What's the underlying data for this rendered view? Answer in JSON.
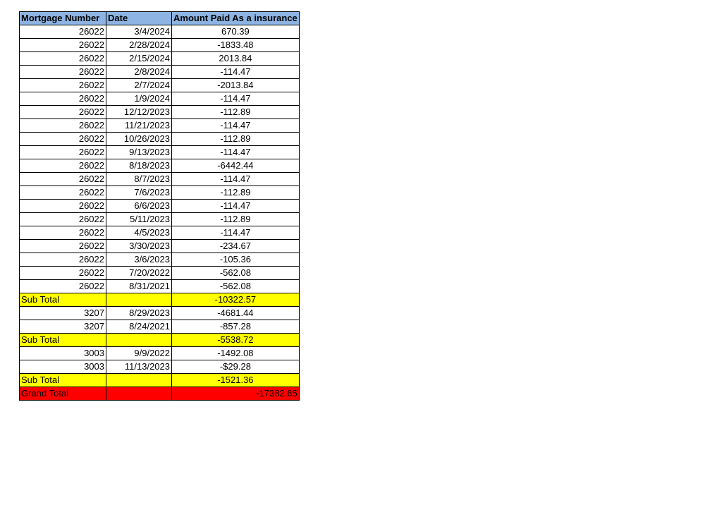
{
  "headers": {
    "mortgage_number": "Mortgage Number",
    "date": "Date",
    "amount": "Amount Paid As a insurance"
  },
  "colors": {
    "header_bg": "#8db4e2",
    "subtotal_bg": "#ffff00",
    "grandtotal_bg": "#ff0000"
  },
  "groups": [
    {
      "rows": [
        {
          "mortgage": "26022",
          "date": "3/4/2024",
          "amount": "670.39"
        },
        {
          "mortgage": "26022",
          "date": "2/28/2024",
          "amount": "-1833.48"
        },
        {
          "mortgage": "26022",
          "date": "2/15/2024",
          "amount": "2013.84"
        },
        {
          "mortgage": "26022",
          "date": "2/8/2024",
          "amount": "-114.47"
        },
        {
          "mortgage": "26022",
          "date": "2/7/2024",
          "amount": "-2013.84"
        },
        {
          "mortgage": "26022",
          "date": "1/9/2024",
          "amount": "-114.47"
        },
        {
          "mortgage": "26022",
          "date": "12/12/2023",
          "amount": "-112.89"
        },
        {
          "mortgage": "26022",
          "date": "11/21/2023",
          "amount": "-114.47"
        },
        {
          "mortgage": "26022",
          "date": "10/26/2023",
          "amount": "-112.89"
        },
        {
          "mortgage": "26022",
          "date": "9/13/2023",
          "amount": "-114.47"
        },
        {
          "mortgage": "26022",
          "date": "8/18/2023",
          "amount": "-6442.44"
        },
        {
          "mortgage": "26022",
          "date": "8/7/2023",
          "amount": "-114.47"
        },
        {
          "mortgage": "26022",
          "date": "7/6/2023",
          "amount": "-112.89"
        },
        {
          "mortgage": "26022",
          "date": "6/6/2023",
          "amount": "-114.47"
        },
        {
          "mortgage": "26022",
          "date": "5/11/2023",
          "amount": "-112.89"
        },
        {
          "mortgage": "26022",
          "date": "4/5/2023",
          "amount": "-114.47"
        },
        {
          "mortgage": "26022",
          "date": "3/30/2023",
          "amount": "-234.67"
        },
        {
          "mortgage": "26022",
          "date": "3/6/2023",
          "amount": "-105.36"
        },
        {
          "mortgage": "26022",
          "date": "7/20/2022",
          "amount": "-562.08"
        },
        {
          "mortgage": "26022",
          "date": "8/31/2021",
          "amount": "-562.08"
        }
      ],
      "subtotal_label": "Sub Total",
      "subtotal_amount": "-10322.57"
    },
    {
      "rows": [
        {
          "mortgage": "3207",
          "date": "8/29/2023",
          "amount": "-4681.44"
        },
        {
          "mortgage": "3207",
          "date": "8/24/2021",
          "amount": "-857.28"
        }
      ],
      "subtotal_label": "Sub Total",
      "subtotal_amount": "-5538.72"
    },
    {
      "rows": [
        {
          "mortgage": "3003",
          "date": "9/9/2022",
          "amount": "-1492.08"
        },
        {
          "mortgage": "3003",
          "date": "11/13/2023",
          "amount": "-$29.28"
        }
      ],
      "subtotal_label": "Sub Total",
      "subtotal_amount": "-1521.36"
    }
  ],
  "grand_total": {
    "label": "Grand Total",
    "amount": "-17382.65"
  }
}
